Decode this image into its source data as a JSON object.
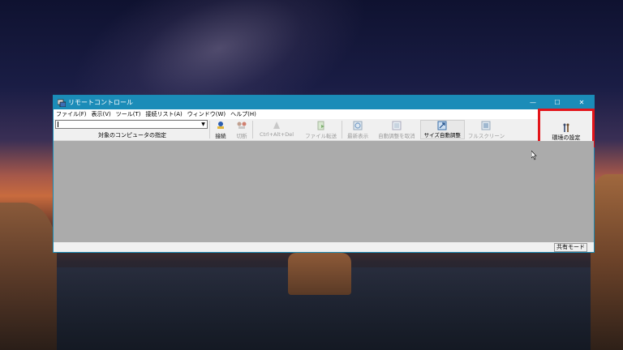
{
  "window": {
    "title": "リモートコントロール",
    "controls": {
      "minimize": "—",
      "maximize": "☐",
      "close": "✕"
    }
  },
  "menu": [
    "ファイル(F)",
    "表示(V)",
    "ツール(T)",
    "接続リスト(A)",
    "ウィンドウ(W)",
    "ヘルプ(H)"
  ],
  "toolbar": {
    "target_label": "対象のコンピュータの指定",
    "target_value": "",
    "connect": "接続",
    "disconnect": "切断",
    "ctrl_alt_del": "Ctrl+Alt+Del",
    "file_transfer": "ファイル転送",
    "refresh": "最新表示",
    "cancel_auto_adjust": "自動調整を取消",
    "size_auto_adjust": "サイズ自動調整",
    "fullscreen": "フルスクリーン",
    "env_settings": "環境の設定"
  },
  "statusbar": {
    "mode": "共有モード"
  },
  "colors": {
    "titlebar": "#1b8cb8",
    "highlight_box": "#e3141a",
    "content_bg": "#ababab"
  }
}
